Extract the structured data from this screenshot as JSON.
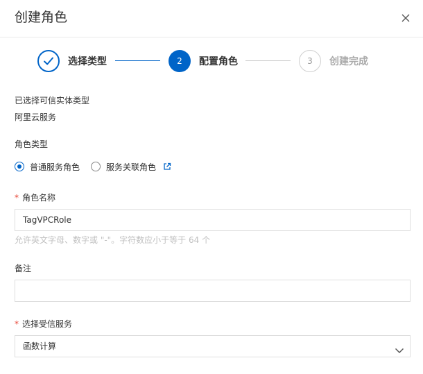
{
  "dialog": {
    "title": "创建角色",
    "close_icon": "close-icon"
  },
  "steps": [
    {
      "label": "选择类型",
      "state": "done",
      "icon": "check-icon"
    },
    {
      "label": "配置角色",
      "state": "active",
      "number": "2"
    },
    {
      "label": "创建完成",
      "state": "pending",
      "number": "3"
    }
  ],
  "trusted_entity": {
    "label": "已选择可信实体类型",
    "value": "阿里云服务"
  },
  "role_type": {
    "label": "角色类型",
    "options": [
      {
        "label": "普通服务角色",
        "checked": true
      },
      {
        "label": "服务关联角色",
        "checked": false
      }
    ],
    "link_icon": "external-link-icon"
  },
  "role_name": {
    "required_mark": "*",
    "label": "角色名称",
    "value": "TagVPCRole",
    "hint": "允许英文字母、数字或 \"-\"。字符数应小于等于 64 个"
  },
  "remark": {
    "label": "备注",
    "value": ""
  },
  "trusted_service": {
    "required_mark": "*",
    "label": "选择受信服务",
    "value": "函数计算",
    "arrow_icon": "chevron-down-icon"
  },
  "colors": {
    "primary": "#0064c8",
    "required": "#e84738",
    "border": "#dedede"
  }
}
